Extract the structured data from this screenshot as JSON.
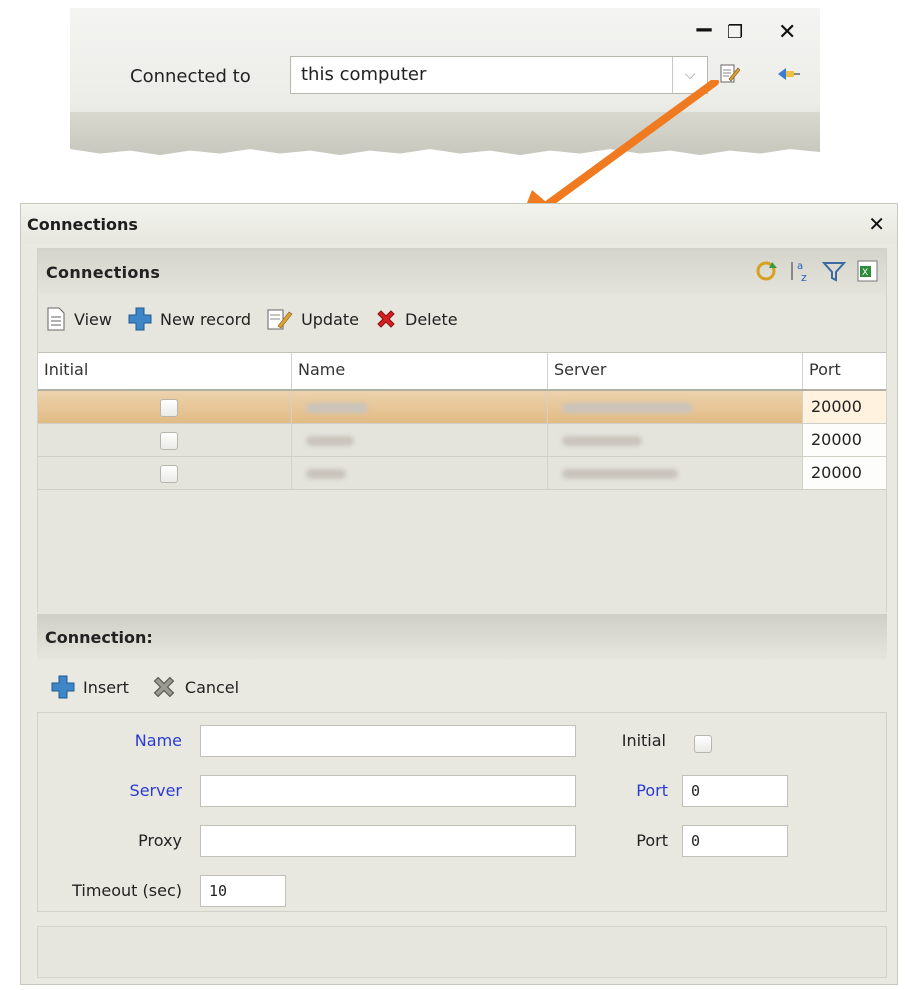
{
  "window_controls": {
    "minimize": "‒",
    "maximize": "❐",
    "close": "✕"
  },
  "top_bar": {
    "connected_to_label": "Connected to",
    "connected_to_value": "this computer"
  },
  "dialog": {
    "title": "Connections",
    "close": "✕"
  },
  "connections_panel": {
    "title": "Connections",
    "toolbar": {
      "view": "View",
      "new_record": "New record",
      "update": "Update",
      "delete": "Delete"
    },
    "columns": [
      "Initial",
      "Name",
      "Server",
      "Port"
    ],
    "rows": [
      {
        "port": "20000",
        "selected": true
      },
      {
        "port": "20000",
        "selected": false
      },
      {
        "port": "20000",
        "selected": false
      }
    ]
  },
  "connection_form": {
    "title": "Connection:",
    "insert": "Insert",
    "cancel": "Cancel",
    "name_label": "Name",
    "server_label": "Server",
    "proxy_label": "Proxy",
    "timeout_label": "Timeout (sec)",
    "initial_label": "Initial",
    "port_label": "Port",
    "proxy_port_label": "Port",
    "name_value": "",
    "server_value": "",
    "proxy_value": "",
    "timeout_value": "10",
    "port_value": "0",
    "proxy_port_value": "0"
  },
  "colors": {
    "selection": "#e2bb85",
    "required_label": "#2b3bd0",
    "arrow": "#f07a20",
    "panel_bg": "#e6e6de"
  }
}
